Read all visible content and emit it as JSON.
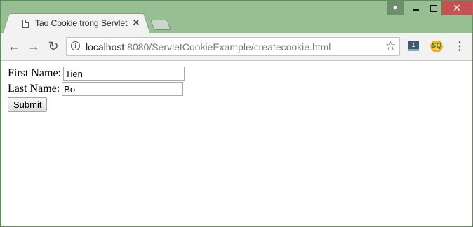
{
  "browser": {
    "tab": {
      "title": "Tao Cookie trong Servlet",
      "close_glyph": "✕",
      "icon": "page-icon"
    },
    "window_controls": {
      "profile_icon": "person-icon",
      "minimize_icon": "minimize-icon",
      "maximize_icon": "maximize-icon",
      "close_glyph": "✕"
    },
    "toolbar": {
      "back_glyph": "←",
      "forward_glyph": "→",
      "reload_glyph": "↻",
      "url_host": "localhost",
      "url_rest": ":8080/ServletCookieExample/createcookie.html",
      "info_glyph": "i",
      "star_glyph": "☆",
      "extension1_badge": "1",
      "extension2_label": "SQ",
      "menu_glyph": "⋮"
    }
  },
  "page": {
    "form": {
      "first_name_label": "First Name:",
      "first_name_value": "Tien",
      "last_name_label": "Last Name:",
      "last_name_value": "Bo",
      "submit_label": "Submit"
    }
  },
  "colors": {
    "frame": "#98bf93",
    "close_button": "#c75050",
    "toolbar": "#f2f2f2"
  }
}
